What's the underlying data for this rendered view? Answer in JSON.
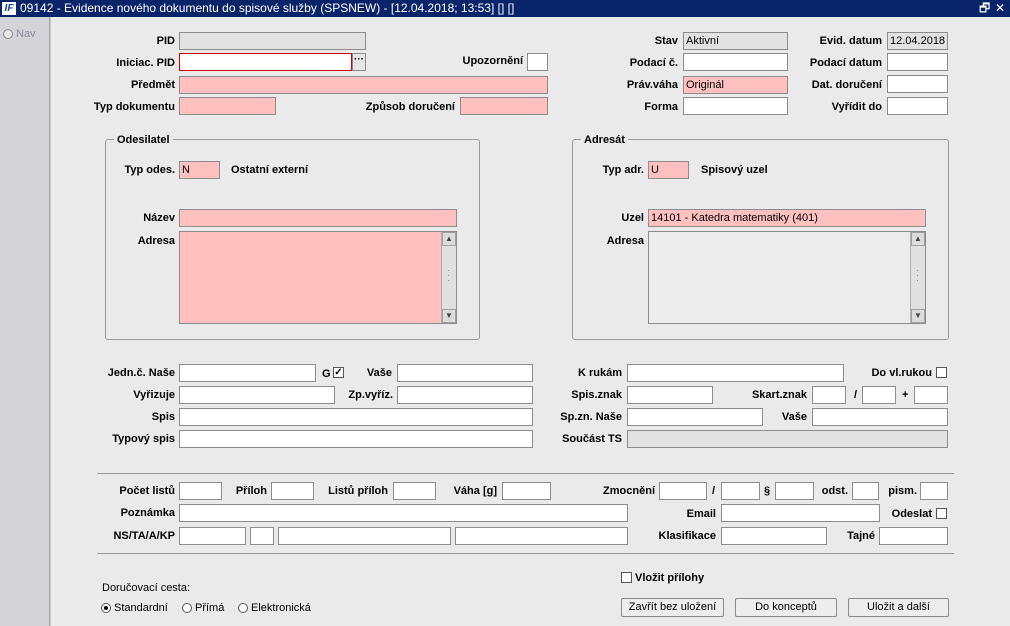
{
  "window": {
    "title": "09142 - Evidence nového dokumentu do spisové služby (SPSNEW) - [12.04.2018; 13:53] [] []",
    "logo": "IF",
    "restore_icon": "restore-icon",
    "close_icon": "close-icon",
    "restore_glyph": "🗗",
    "close_glyph": "✕"
  },
  "nav": {
    "label": "Nav"
  },
  "header": {
    "pid": {
      "label": "PID",
      "value": ""
    },
    "iniciac_pid": {
      "label": "Iniciac. PID",
      "value": "",
      "lookup": "···"
    },
    "upozorneni": {
      "label": "Upozornění",
      "value": ""
    },
    "predmet": {
      "label": "Předmět",
      "value": ""
    },
    "typ_dokumentu": {
      "label": "Typ dokumentu",
      "value": ""
    },
    "zpusob_doruceni": {
      "label": "Způsob doručení",
      "value": ""
    },
    "stav": {
      "label": "Stav",
      "value": "Aktivní"
    },
    "evid_datum": {
      "label": "Evid. datum",
      "value": "12.04.2018"
    },
    "podaci_c": {
      "label": "Podací č.",
      "value": ""
    },
    "podaci_datum": {
      "label": "Podací datum",
      "value": ""
    },
    "prav_vaha": {
      "label": "Práv.váha",
      "value": "Originál"
    },
    "dat_doruceni": {
      "label": "Dat. doručení",
      "value": ""
    },
    "forma": {
      "label": "Forma",
      "value": ""
    },
    "vyridit_do": {
      "label": "Vyřídit do",
      "value": ""
    }
  },
  "odesilatel": {
    "title": "Odesilatel",
    "typ_label": "Typ odes.",
    "typ_value": "N",
    "typ_desc": "Ostatní externí",
    "nazev_label": "Název",
    "nazev_value": "",
    "adresa_label": "Adresa",
    "adresa_value": ""
  },
  "adresat": {
    "title": "Adresát",
    "typ_label": "Typ adr.",
    "typ_value": "U",
    "typ_desc": "Spisový uzel",
    "uzel_label": "Uzel",
    "uzel_value": "14101 - Katedra matematiky (401)",
    "adresa_label": "Adresa",
    "adresa_value": ""
  },
  "middle": {
    "jedn_nase": {
      "label": "Jedn.č. Naše",
      "value": ""
    },
    "g_label": "G",
    "g_checked": "✓",
    "jedn_vase": {
      "label": "Vaše",
      "value": ""
    },
    "k_rukam": {
      "label": "K rukám",
      "value": ""
    },
    "do_vl_rukou": {
      "label": "Do vl.rukou"
    },
    "vyrizuje": {
      "label": "Vyřizuje",
      "value": ""
    },
    "zp_vyriz": {
      "label": "Zp.vyříz.",
      "value": ""
    },
    "spis_znak": {
      "label": "Spis.znak",
      "value": ""
    },
    "skart_znak": {
      "label": "Skart.znak",
      "value": "",
      "sep1": "/",
      "sep2": "+"
    },
    "spis": {
      "label": "Spis",
      "value": ""
    },
    "sp_zn_nase": {
      "label": "Sp.zn. Naše",
      "value": ""
    },
    "sp_zn_vase": {
      "label": "Vaše",
      "value": ""
    },
    "typovy_spis": {
      "label": "Typový spis",
      "value": ""
    },
    "soucast_ts": {
      "label": "Součást TS",
      "value": ""
    }
  },
  "lower": {
    "pocet_listu": {
      "label": "Počet listů",
      "value": ""
    },
    "priloh": {
      "label": "Příloh",
      "value": ""
    },
    "listu_priloh": {
      "label": "Listů příloh",
      "value": ""
    },
    "vaha": {
      "label": "Váha [g]",
      "value": ""
    },
    "zmocneni": {
      "label": "Zmocnění",
      "sep": "/",
      "par": "§",
      "odst": "odst.",
      "pism": "pism."
    },
    "poznamka": {
      "label": "Poznámka",
      "value": ""
    },
    "email": {
      "label": "Email",
      "value": ""
    },
    "odeslat": {
      "label": "Odeslat"
    },
    "ns": {
      "label": "NS/TA/A/KP"
    },
    "klasifikace": {
      "label": "Klasifikace",
      "value": ""
    },
    "tajne": {
      "label": "Tajné",
      "value": ""
    }
  },
  "footer": {
    "vlozit_prilohy": "Vložit přílohy",
    "dorucovaci_cesta": "Doručovací cesta:",
    "options": [
      "Standardní",
      "Přímá",
      "Elektronická"
    ],
    "buttons": {
      "zavrit": "Zavřít bez uložení",
      "koncept": "Do konceptů",
      "ulozit": "Uložit a další"
    }
  }
}
